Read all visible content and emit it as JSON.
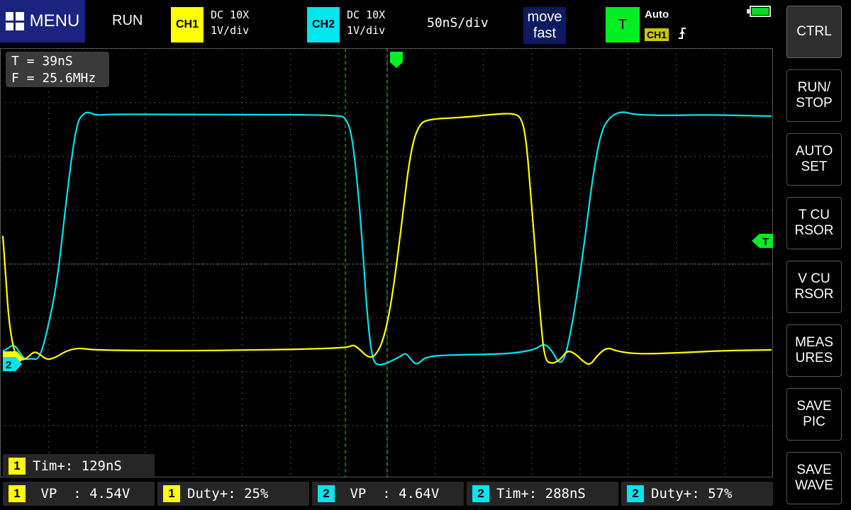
{
  "header": {
    "menu_label": "MENU",
    "run_state": "RUN",
    "ch1": {
      "label": "CH1",
      "coupling": "DC 10X",
      "scale": "1V/div"
    },
    "ch2": {
      "label": "CH2",
      "coupling": "DC 10X",
      "scale": "1V/div"
    },
    "timebase": "50nS/div",
    "move": {
      "line1": "move",
      "line2": "fast"
    },
    "trigger": {
      "label": "T",
      "mode": "Auto",
      "source": "CH1",
      "edge_icon": "rising-edge-icon"
    }
  },
  "cursor_readout": {
    "t": "T = 39nS",
    "f": "F = 25.6MHz"
  },
  "markers": {
    "ch2_ground": "2",
    "trigger_level": "T"
  },
  "side_buttons": [
    {
      "label": "CTRL"
    },
    {
      "label": "RUN/\nSTOP"
    },
    {
      "label": "AUTO\nSET"
    },
    {
      "label": "T CU\nRSOR"
    },
    {
      "label": "V CU\nRSOR"
    },
    {
      "label": "MEAS\nURES"
    },
    {
      "label": "SAVE\nPIC"
    },
    {
      "label": "SAVE\nWAVE"
    }
  ],
  "measurements": [
    {
      "ch": "1",
      "text": "Tim+: 129nS"
    },
    {
      "ch": "1",
      "text": " VP  : 4.54V"
    },
    {
      "ch": "1",
      "text": "Duty+: 25%"
    },
    {
      "ch": "2",
      "text": " VP  : 4.64V"
    },
    {
      "ch": "2",
      "text": "Tim+: 288nS"
    },
    {
      "ch": "2",
      "text": "Duty+: 57%"
    }
  ],
  "colors": {
    "ch1": "#ffff00",
    "ch2": "#00e5ee",
    "trigger": "#00ee22",
    "menu": "#1a237e"
  }
}
